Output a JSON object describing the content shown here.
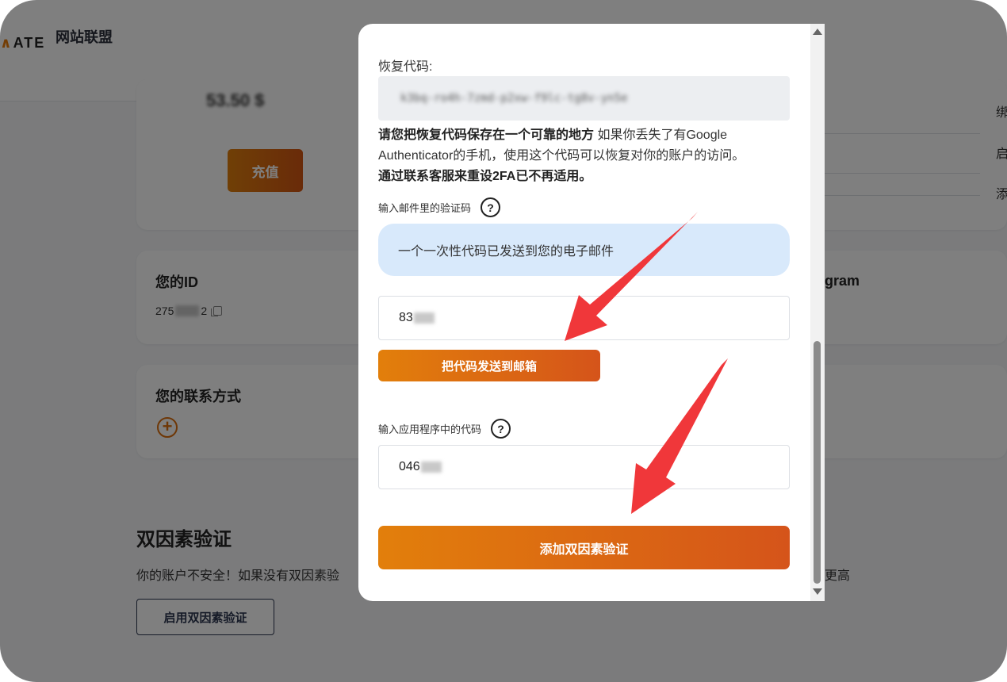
{
  "nav": {
    "logo_fragment": "ATE",
    "title": "网站联盟"
  },
  "balance_card": {
    "amount_fragment": "53.50 $",
    "topup_label": "充值"
  },
  "id_card": {
    "title": "您的ID",
    "id_prefix": "275",
    "id_suffix": "2"
  },
  "contact_card": {
    "title": "您的联系方式",
    "add_symbol": "+"
  },
  "right_panel": {
    "item_1": "绑",
    "item_2": "启",
    "item_3": "添",
    "telegram_fragment": "gram"
  },
  "two_factor": {
    "title": "双因素验证",
    "description": "你的账户不安全！如果没有双因素验",
    "description_tail": "更高",
    "enable_label": "启用双因素验证"
  },
  "modal": {
    "recovery_label": "恢复代码:",
    "recovery_code": "k3bq-ro4h-7zmd-p2xw-f9lc-tg8v-yn5e",
    "warning_bold": "请您把恢复代码保存在一个可靠的地方",
    "warning_text": " 如果你丢失了有Google Authenticator的手机，使用这个代码可以恢复对你的账户的访问。",
    "warning_bold_2": "通过联系客服来重设2FA已不再适用。",
    "email_code_label": "输入邮件里的验证码",
    "help_symbol": "?",
    "notice": "一个一次性代码已发送到您的电子邮件",
    "email_code_value": "83",
    "send_button": "把代码发送到邮箱",
    "app_code_label": "输入应用程序中的代码",
    "app_code_value": "046",
    "add_button": "添加双因素验证"
  }
}
